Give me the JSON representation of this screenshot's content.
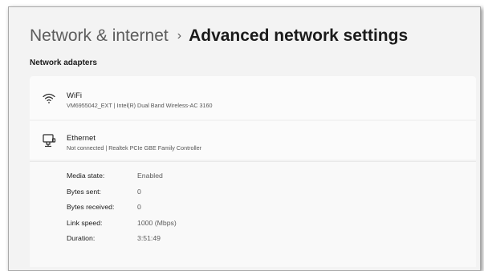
{
  "header": {
    "parent": "Network & internet",
    "separator": "›",
    "current": "Advanced network settings"
  },
  "section": {
    "title": "Network adapters"
  },
  "adapters": [
    {
      "name": "WiFi",
      "description": "VM6955042_EXT | Intel(R) Dual Band Wireless-AC 3160",
      "icon": "wifi-icon"
    },
    {
      "name": "Ethernet",
      "description": "Not connected | Realtek PCIe GBE Family Controller",
      "icon": "ethernet-icon"
    }
  ],
  "ethernet_details": [
    {
      "label": "Media state:",
      "value": "Enabled"
    },
    {
      "label": "Bytes sent:",
      "value": "0"
    },
    {
      "label": "Bytes received:",
      "value": "0"
    },
    {
      "label": "Link speed:",
      "value": "1000 (Mbps)"
    },
    {
      "label": "Duration:",
      "value": "3:51:49"
    }
  ]
}
